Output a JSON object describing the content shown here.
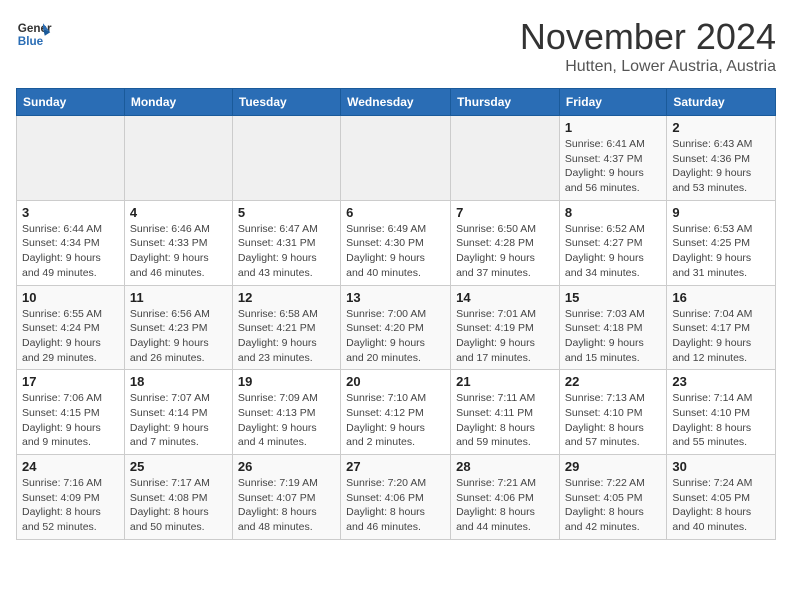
{
  "logo": {
    "line1": "General",
    "line2": "Blue"
  },
  "title": "November 2024",
  "subtitle": "Hutten, Lower Austria, Austria",
  "days_of_week": [
    "Sunday",
    "Monday",
    "Tuesday",
    "Wednesday",
    "Thursday",
    "Friday",
    "Saturday"
  ],
  "weeks": [
    [
      {
        "day": "",
        "detail": ""
      },
      {
        "day": "",
        "detail": ""
      },
      {
        "day": "",
        "detail": ""
      },
      {
        "day": "",
        "detail": ""
      },
      {
        "day": "",
        "detail": ""
      },
      {
        "day": "1",
        "detail": "Sunrise: 6:41 AM\nSunset: 4:37 PM\nDaylight: 9 hours and 56 minutes."
      },
      {
        "day": "2",
        "detail": "Sunrise: 6:43 AM\nSunset: 4:36 PM\nDaylight: 9 hours and 53 minutes."
      }
    ],
    [
      {
        "day": "3",
        "detail": "Sunrise: 6:44 AM\nSunset: 4:34 PM\nDaylight: 9 hours and 49 minutes."
      },
      {
        "day": "4",
        "detail": "Sunrise: 6:46 AM\nSunset: 4:33 PM\nDaylight: 9 hours and 46 minutes."
      },
      {
        "day": "5",
        "detail": "Sunrise: 6:47 AM\nSunset: 4:31 PM\nDaylight: 9 hours and 43 minutes."
      },
      {
        "day": "6",
        "detail": "Sunrise: 6:49 AM\nSunset: 4:30 PM\nDaylight: 9 hours and 40 minutes."
      },
      {
        "day": "7",
        "detail": "Sunrise: 6:50 AM\nSunset: 4:28 PM\nDaylight: 9 hours and 37 minutes."
      },
      {
        "day": "8",
        "detail": "Sunrise: 6:52 AM\nSunset: 4:27 PM\nDaylight: 9 hours and 34 minutes."
      },
      {
        "day": "9",
        "detail": "Sunrise: 6:53 AM\nSunset: 4:25 PM\nDaylight: 9 hours and 31 minutes."
      }
    ],
    [
      {
        "day": "10",
        "detail": "Sunrise: 6:55 AM\nSunset: 4:24 PM\nDaylight: 9 hours and 29 minutes."
      },
      {
        "day": "11",
        "detail": "Sunrise: 6:56 AM\nSunset: 4:23 PM\nDaylight: 9 hours and 26 minutes."
      },
      {
        "day": "12",
        "detail": "Sunrise: 6:58 AM\nSunset: 4:21 PM\nDaylight: 9 hours and 23 minutes."
      },
      {
        "day": "13",
        "detail": "Sunrise: 7:00 AM\nSunset: 4:20 PM\nDaylight: 9 hours and 20 minutes."
      },
      {
        "day": "14",
        "detail": "Sunrise: 7:01 AM\nSunset: 4:19 PM\nDaylight: 9 hours and 17 minutes."
      },
      {
        "day": "15",
        "detail": "Sunrise: 7:03 AM\nSunset: 4:18 PM\nDaylight: 9 hours and 15 minutes."
      },
      {
        "day": "16",
        "detail": "Sunrise: 7:04 AM\nSunset: 4:17 PM\nDaylight: 9 hours and 12 minutes."
      }
    ],
    [
      {
        "day": "17",
        "detail": "Sunrise: 7:06 AM\nSunset: 4:15 PM\nDaylight: 9 hours and 9 minutes."
      },
      {
        "day": "18",
        "detail": "Sunrise: 7:07 AM\nSunset: 4:14 PM\nDaylight: 9 hours and 7 minutes."
      },
      {
        "day": "19",
        "detail": "Sunrise: 7:09 AM\nSunset: 4:13 PM\nDaylight: 9 hours and 4 minutes."
      },
      {
        "day": "20",
        "detail": "Sunrise: 7:10 AM\nSunset: 4:12 PM\nDaylight: 9 hours and 2 minutes."
      },
      {
        "day": "21",
        "detail": "Sunrise: 7:11 AM\nSunset: 4:11 PM\nDaylight: 8 hours and 59 minutes."
      },
      {
        "day": "22",
        "detail": "Sunrise: 7:13 AM\nSunset: 4:10 PM\nDaylight: 8 hours and 57 minutes."
      },
      {
        "day": "23",
        "detail": "Sunrise: 7:14 AM\nSunset: 4:10 PM\nDaylight: 8 hours and 55 minutes."
      }
    ],
    [
      {
        "day": "24",
        "detail": "Sunrise: 7:16 AM\nSunset: 4:09 PM\nDaylight: 8 hours and 52 minutes."
      },
      {
        "day": "25",
        "detail": "Sunrise: 7:17 AM\nSunset: 4:08 PM\nDaylight: 8 hours and 50 minutes."
      },
      {
        "day": "26",
        "detail": "Sunrise: 7:19 AM\nSunset: 4:07 PM\nDaylight: 8 hours and 48 minutes."
      },
      {
        "day": "27",
        "detail": "Sunrise: 7:20 AM\nSunset: 4:06 PM\nDaylight: 8 hours and 46 minutes."
      },
      {
        "day": "28",
        "detail": "Sunrise: 7:21 AM\nSunset: 4:06 PM\nDaylight: 8 hours and 44 minutes."
      },
      {
        "day": "29",
        "detail": "Sunrise: 7:22 AM\nSunset: 4:05 PM\nDaylight: 8 hours and 42 minutes."
      },
      {
        "day": "30",
        "detail": "Sunrise: 7:24 AM\nSunset: 4:05 PM\nDaylight: 8 hours and 40 minutes."
      }
    ]
  ]
}
